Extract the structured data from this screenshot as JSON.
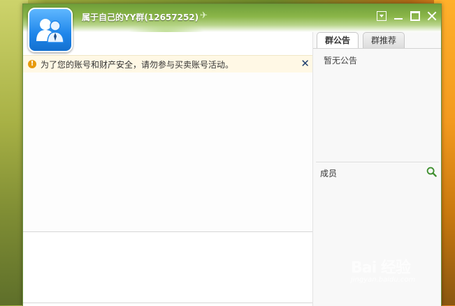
{
  "window": {
    "title": "属于自己的YY群(12657252)",
    "controls": [
      "dropdown",
      "minimize",
      "maximize",
      "close"
    ]
  },
  "notice": {
    "text": "为了您的账号和财产安全，请勿参与买卖账号活动。",
    "close_label": "✕"
  },
  "tabs": [
    {
      "label": "群公告",
      "active": true
    },
    {
      "label": "群推荐",
      "active": false
    }
  ],
  "announcement": {
    "text": "暂无公告"
  },
  "members": {
    "label": "成员"
  },
  "watermark": {
    "line1": "Bai 经验",
    "line2": "jingyan.baidu.com"
  },
  "colors": {
    "title_green": "#6f9f39",
    "avatar_blue": "#1f86ea",
    "warning": "#e79a0c"
  }
}
